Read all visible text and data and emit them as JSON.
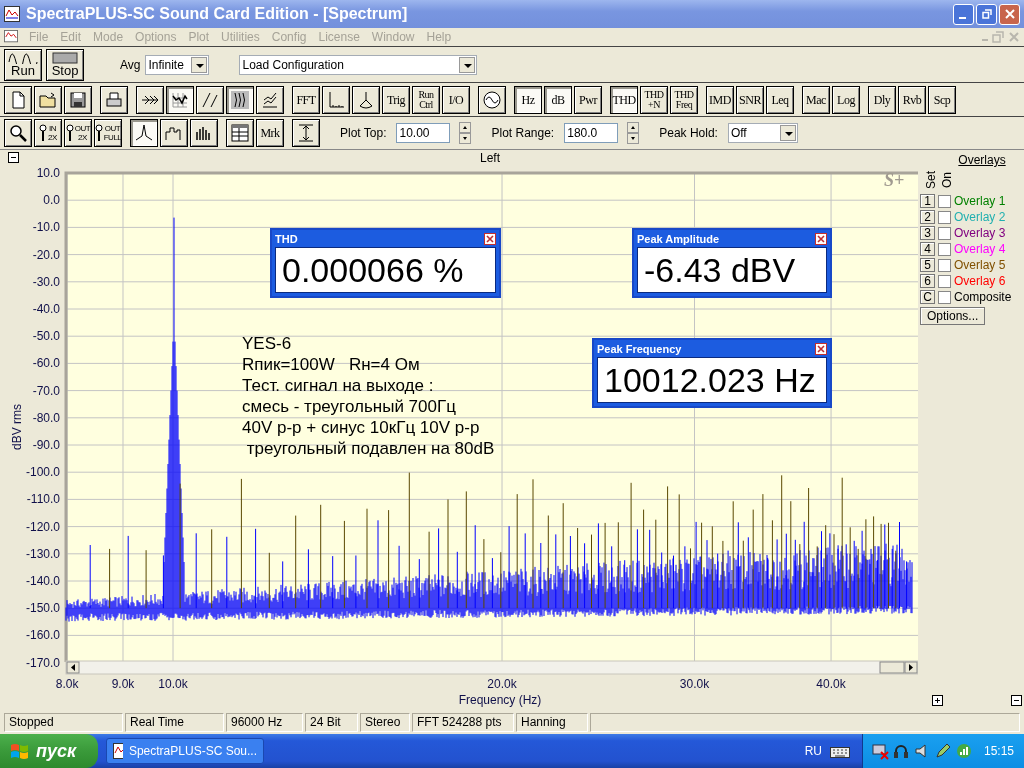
{
  "window": {
    "title": "SpectraPLUS-SC Sound Card Edition - [Spectrum]"
  },
  "menu": [
    {
      "label": "File",
      "disabled": true
    },
    {
      "label": "Edit",
      "disabled": true
    },
    {
      "label": "Mode",
      "disabled": true
    },
    {
      "label": "Options",
      "disabled": true
    },
    {
      "label": "Plot",
      "disabled": true
    },
    {
      "label": "Utilities",
      "disabled": true
    },
    {
      "label": "Config",
      "disabled": true
    },
    {
      "label": "License",
      "disabled": true
    },
    {
      "label": "Window",
      "disabled": true
    },
    {
      "label": "Help",
      "disabled": true
    }
  ],
  "toolbar_1": {
    "run": "Run",
    "stop": "Stop",
    "avg_label": "Avg",
    "avg_value": "Infinite",
    "config_value": "Load Configuration"
  },
  "toolbar_2": [
    [
      {
        "kind": "icon",
        "pressed": false
      },
      {
        "kind": "icon",
        "pressed": false
      },
      {
        "kind": "icon",
        "pressed": false
      }
    ],
    [
      {
        "kind": "icon",
        "pressed": false
      }
    ],
    [
      {
        "kind": "icon",
        "pressed": false
      },
      {
        "kind": "icon",
        "pressed": true
      },
      {
        "kind": "icon",
        "pressed": false
      },
      {
        "kind": "icon",
        "pressed": true
      },
      {
        "kind": "icon",
        "pressed": false
      }
    ],
    [
      {
        "kind": "text",
        "lines": [
          "FFT"
        ],
        "pressed": false
      },
      {
        "kind": "icon",
        "pressed": false
      },
      {
        "kind": "icon",
        "pressed": false
      },
      {
        "kind": "text",
        "lines": [
          "Trig"
        ],
        "pressed": false
      },
      {
        "kind": "text",
        "lines": [
          "Run",
          "Ctrl"
        ],
        "pressed": false
      },
      {
        "kind": "text",
        "lines": [
          "I/O"
        ],
        "pressed": false
      }
    ],
    [
      {
        "kind": "icon",
        "pressed": false
      }
    ],
    [
      {
        "kind": "text",
        "lines": [
          "Hz"
        ],
        "pressed": true
      },
      {
        "kind": "text",
        "lines": [
          "dB"
        ],
        "pressed": true
      },
      {
        "kind": "text",
        "lines": [
          "Pwr"
        ],
        "pressed": false
      }
    ],
    [
      {
        "kind": "text",
        "lines": [
          "THD"
        ],
        "pressed": true
      },
      {
        "kind": "text",
        "lines": [
          "THD",
          "+N"
        ],
        "pressed": false
      },
      {
        "kind": "text",
        "lines": [
          "THD",
          "Freq"
        ],
        "pressed": false
      }
    ],
    [
      {
        "kind": "text",
        "lines": [
          "IMD"
        ],
        "pressed": false
      },
      {
        "kind": "text",
        "lines": [
          "SNR"
        ],
        "pressed": false
      },
      {
        "kind": "text",
        "lines": [
          "Leq"
        ],
        "pressed": false
      }
    ],
    [
      {
        "kind": "text",
        "lines": [
          "Mac"
        ],
        "pressed": false
      },
      {
        "kind": "text",
        "lines": [
          "Log"
        ],
        "pressed": false
      }
    ],
    [
      {
        "kind": "text",
        "lines": [
          "Dly"
        ],
        "pressed": false
      },
      {
        "kind": "text",
        "lines": [
          "Rvb"
        ],
        "pressed": false
      },
      {
        "kind": "text",
        "lines": [
          "Scp"
        ],
        "pressed": false
      }
    ]
  ],
  "toolbar_3": [
    [
      {
        "kind": "icon",
        "pressed": false
      },
      {
        "kind": "zoom",
        "lines": [
          "IN",
          "2X"
        ],
        "pressed": false
      },
      {
        "kind": "zoom",
        "lines": [
          "OUT",
          "2X"
        ],
        "pressed": false
      },
      {
        "kind": "zoom",
        "lines": [
          "OUT",
          "FULL"
        ],
        "pressed": false
      }
    ],
    [
      {
        "kind": "icon",
        "pressed": true
      },
      {
        "kind": "icon",
        "pressed": false
      },
      {
        "kind": "icon",
        "pressed": false
      }
    ],
    [
      {
        "kind": "icon",
        "pressed": false
      },
      {
        "kind": "text",
        "lines": [
          "Mrk"
        ],
        "pressed": false
      }
    ],
    [
      {
        "kind": "icon",
        "pressed": false
      }
    ]
  ],
  "plot_settings": [
    {
      "label": "Plot Top:",
      "value": "10.00",
      "kind": "spin"
    },
    {
      "label": "Plot Range:",
      "value": "180.0",
      "kind": "spin"
    },
    {
      "label": "Peak Hold:",
      "value": "Off",
      "kind": "select"
    }
  ],
  "plot": {
    "title": "Left",
    "logo": "S+",
    "ylabel": "dBV rms",
    "xlabel": "Frequency (Hz)",
    "yticks": [
      "10.0",
      "0.0",
      "-10.0",
      "-20.0",
      "-30.0",
      "-40.0",
      "-50.0",
      "-60.0",
      "-70.0",
      "-80.0",
      "-90.0",
      "-100.0",
      "-110.0",
      "-120.0",
      "-130.0",
      "-140.0",
      "-150.0",
      "-160.0",
      "-170.0"
    ],
    "xticks": [
      "8.0k",
      "9.0k",
      "10.0k",
      "20.0k",
      "30.0k",
      "40.0k"
    ],
    "annotation": [
      "YES-6",
      "Rпик=100W   Rн=4 Ом",
      "Тест. сигнал на выходе :",
      "смесь - треугольный 700Гц",
      "40V p-p + синус 10кГц 10V p-p",
      " треугольный подавлен на 80dB"
    ]
  },
  "readouts": [
    {
      "title": "THD",
      "value": "0.000066 %"
    },
    {
      "title": "Peak Amplitude",
      "value": "-6.43 dBV"
    },
    {
      "title": "Peak Frequency",
      "value": "10012.023 Hz"
    }
  ],
  "overlays": {
    "title": "Overlays",
    "set_label": "Set",
    "on_label": "On",
    "options": "Options...",
    "items": [
      {
        "set": "1",
        "name": "Overlay 1",
        "color": "#008000",
        "checked": false
      },
      {
        "set": "2",
        "name": "Overlay 2",
        "color": "#20b0b0",
        "checked": false
      },
      {
        "set": "3",
        "name": "Overlay 3",
        "color": "#800080",
        "checked": false
      },
      {
        "set": "4",
        "name": "Overlay 4",
        "color": "#ff00ff",
        "checked": false
      },
      {
        "set": "5",
        "name": "Overlay 5",
        "color": "#805000",
        "checked": false
      },
      {
        "set": "6",
        "name": "Overlay 6",
        "color": "#ff0000",
        "checked": false
      },
      {
        "set": "C",
        "name": "Composite",
        "color": "#000000",
        "checked": false
      }
    ]
  },
  "status_bar": [
    "Stopped",
    "Real Time",
    "96000 Hz",
    "24 Bit",
    "Stereo",
    "FFT 524288 pts",
    "Hanning"
  ],
  "taskbar": {
    "start": "пуск",
    "task": "SpectraPLUS-SC Sou...",
    "language": "RU",
    "clock": "15:15"
  }
}
